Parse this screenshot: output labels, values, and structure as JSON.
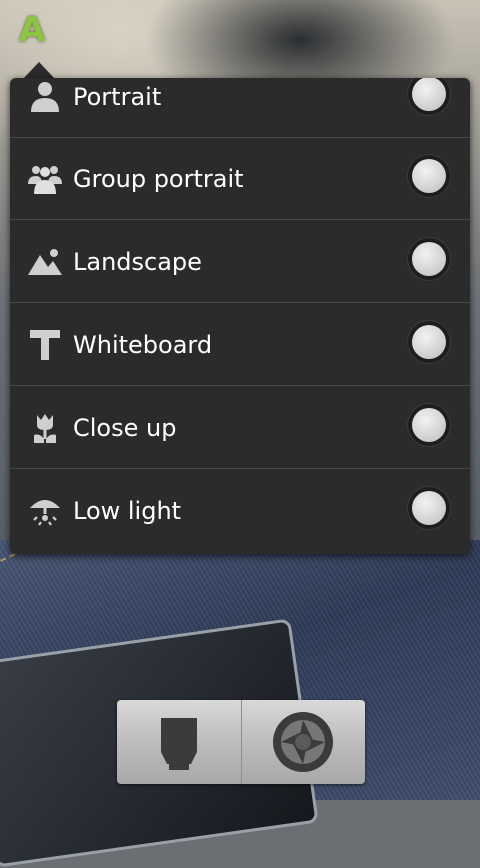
{
  "scene_menu": {
    "items": [
      {
        "label": "Portrait",
        "icon": "portrait-icon"
      },
      {
        "label": "Group portrait",
        "icon": "group-portrait-icon"
      },
      {
        "label": "Landscape",
        "icon": "landscape-icon"
      },
      {
        "label": "Whiteboard",
        "icon": "whiteboard-icon"
      },
      {
        "label": "Close up",
        "icon": "close-up-icon"
      },
      {
        "label": "Low light",
        "icon": "low-light-icon"
      }
    ]
  },
  "scene_indicator": {
    "label": "A",
    "color": "#8cc63f"
  },
  "controls": {
    "left_icon": "front-camera-icon",
    "right_icon": "shutter-icon"
  }
}
